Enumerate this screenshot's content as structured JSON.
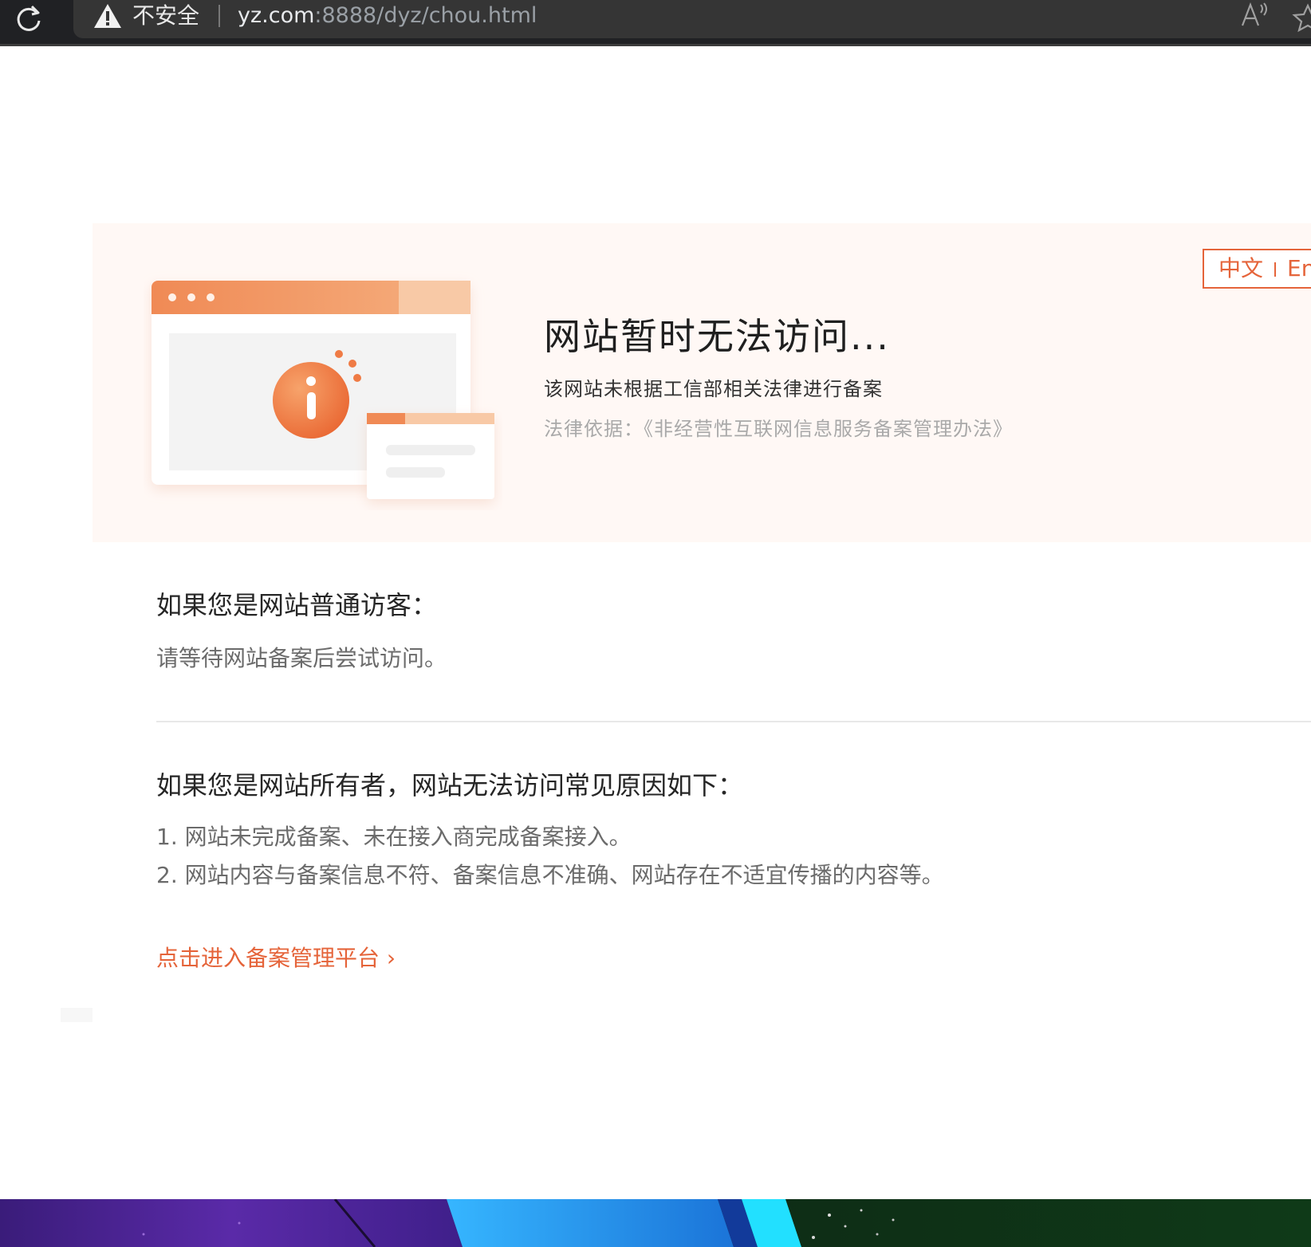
{
  "browser": {
    "security_label": "不安全",
    "url_host": "yz.com",
    "url_rest": ":8888/dyz/chou.html",
    "read_aloud_glyph": "A!"
  },
  "lang_switch": {
    "zh": "中文",
    "en": "En"
  },
  "hero": {
    "title": "网站暂时无法访问...",
    "subtitle": "该网站未根据工信部相关法律进行备案",
    "law": "法律依据：《非经营性互联网信息服务备案管理办法》"
  },
  "visitor": {
    "title": "如果您是网站普通访客：",
    "text": "请等待网站备案后尝试访问。"
  },
  "owner": {
    "title": "如果您是网站所有者，网站无法访问常见原因如下：",
    "reasons": [
      "1. 网站未完成备案、未在接入商完成备案接入。",
      "2. 网站内容与备案信息不符、备案信息不准确、网站存在不适宜传播的内容等。"
    ]
  },
  "link": {
    "label": "点击进入备案管理平台 ›"
  },
  "colors": {
    "accent": "#e5643a",
    "hero_bg": "#fff8f5",
    "browser_bar": "#202124"
  }
}
